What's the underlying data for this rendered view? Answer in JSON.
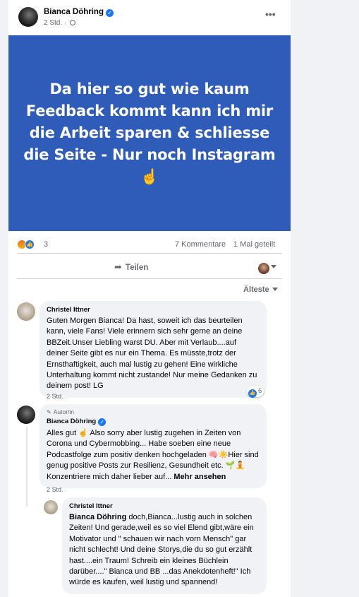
{
  "post": {
    "author": "Bianca Döhring",
    "time": "2 Std.",
    "more": "•••",
    "banner_text": "Da hier so gut wie kaum Feedback kommt kann ich mir die Arbeit sparen & schliesse die Seite - Nur noch Instagram ☝️",
    "banner_color": "#2e5cb8",
    "reaction_count": "3",
    "comments_count": "7 Kommentare",
    "shares_count": "1 Mal geteilt",
    "share_label": "Teilen",
    "sort_label": "Älteste"
  },
  "comments": [
    {
      "author": "Christel Ittner",
      "text": "Guten Morgen Bianca! Da hast, soweit ich das beurteilen kann, viele Fans! Viele erinnern sich sehr gerne an deine BBZeit.Unser Liebling warst DU. Aber mit Verlaub....auf deiner Seite gibt es nur ein Thema. Es müsste,trotz der Ernsthaftigkeit, auch mal lustig zu gehen! Eine wirkliche Unterhaltung kommt nicht zustande! Nur meine Gedanken zu deinem post! LG",
      "time": "2 Std.",
      "reaction_count": "6"
    },
    {
      "badge": "Autor/in",
      "author": "Bianca Döhring",
      "text": "Alles gut ☝️ Also sorry aber lustig zugehen in Zeiten von Corona und Cybermobbing... Habe soeben eine neue Podcastfolge zum positiv denken hochgeladen 🧠☀️Hier sind genug positive Posts zur Resilienz, Gesundheit etc. 🌱🧘 Konzentriere mich daher lieber auf...",
      "more": "Mehr ansehen",
      "time": "2 Std."
    },
    {
      "author": "Christel Ittner",
      "mention": "Bianca Döhring",
      "text": " doch,Bianca...lustig auch in solchen Zeiten! Und gerade,weil es so viel Elend gibt,wäre ein Motivator und \" schauen wir nach vorn Mensch\" gar nicht schlecht! Und deine Storys,die du so gut erzählt hast....ein Traum! Schreib ein kleines Büchlein darüber....\" Bianca und BB ...das Anekdotenheft!\" Ich würde es kaufen, weil lustig und spannend!"
    }
  ]
}
